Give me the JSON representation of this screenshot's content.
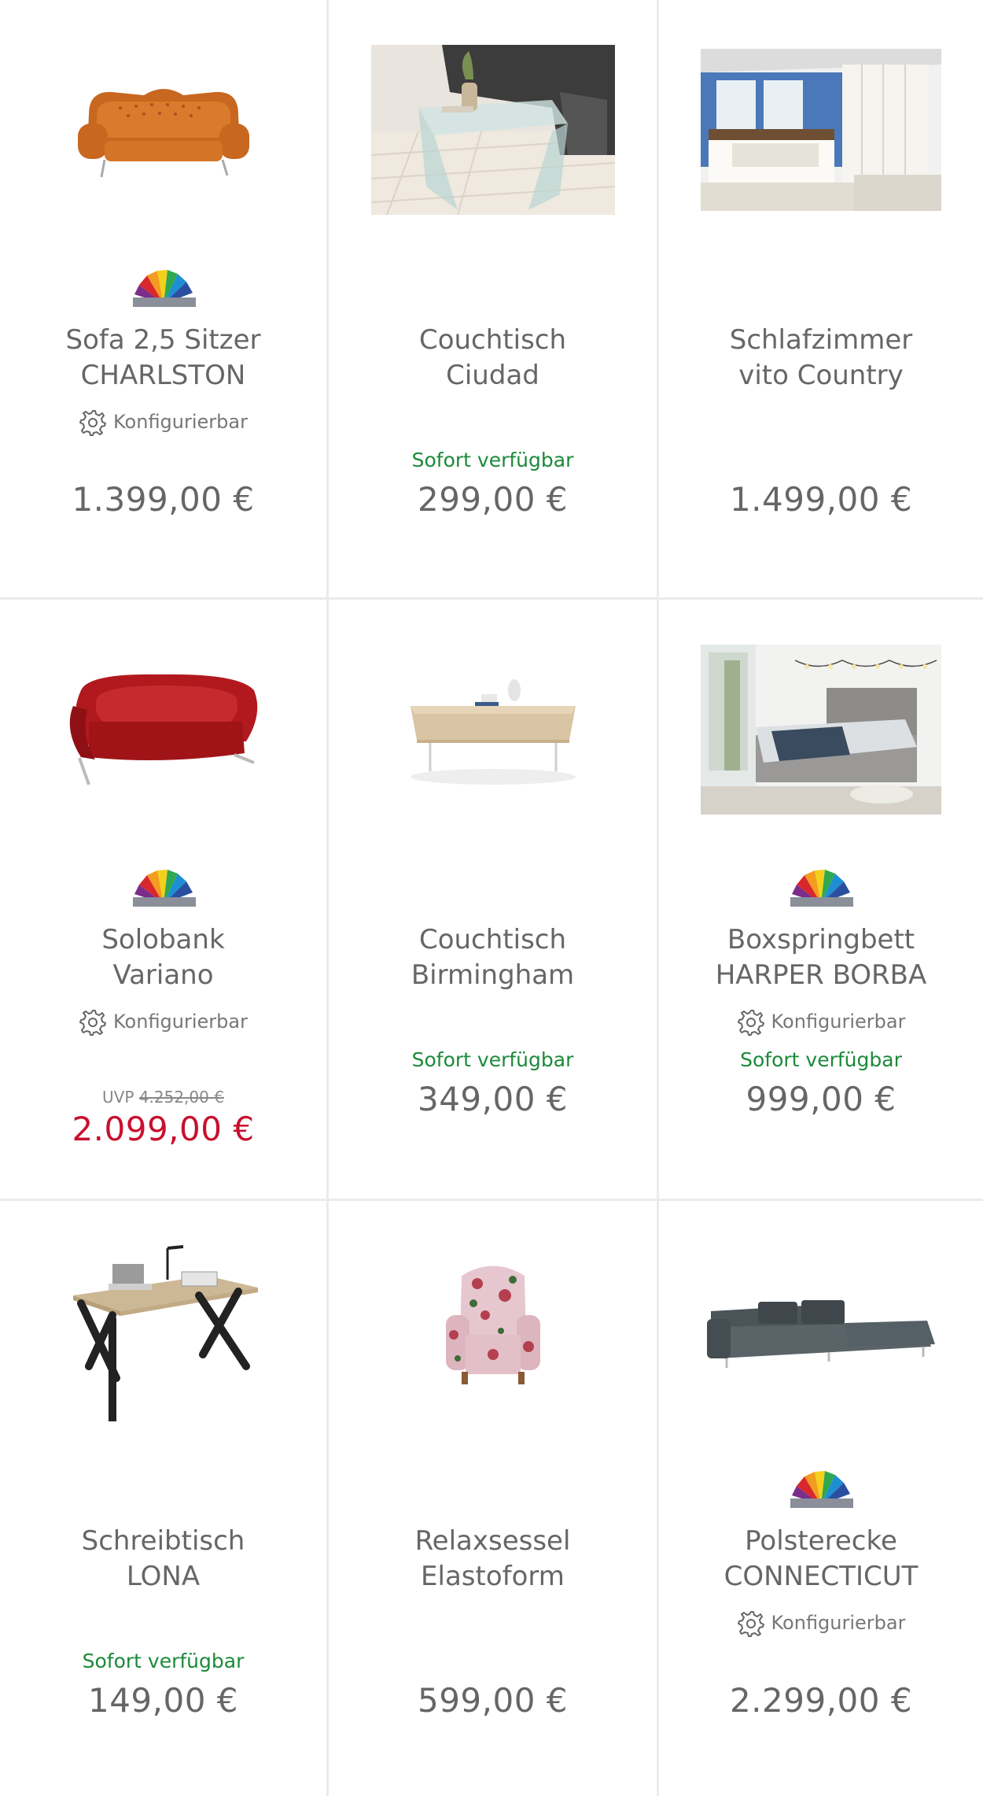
{
  "colors": {
    "price": "#666666",
    "sale_price": "#c8102e",
    "availability": "#1b8a3a",
    "divider": "#ebebeb"
  },
  "products": [
    {
      "image": "orange tufted sofa",
      "title_line1": "Sofa 2,5 Sitzer",
      "title_line2": "CHARLSTON",
      "configurable": "Konfigurierbar",
      "availability": "",
      "uvp_label": "",
      "uvp_value": "",
      "price": "1.399,00 €",
      "color_palette": true
    },
    {
      "image": "glass coffee table",
      "title_line1": "Couchtisch",
      "title_line2": "Ciudad",
      "configurable": "",
      "availability": "Sofort verfügbar",
      "price": "299,00 €",
      "color_palette": false
    },
    {
      "image": "white country bedroom set",
      "title_line1": "Schlafzimmer",
      "title_line2": "vito Country",
      "configurable": "",
      "availability": "",
      "price": "1.499,00 €",
      "color_palette": false
    },
    {
      "image": "red curved bench",
      "title_line1": "Solobank",
      "title_line2": "Variano",
      "configurable": "Konfigurierbar",
      "availability": "",
      "uvp_label": "UVP",
      "uvp_value": "4.252,00 €",
      "price": "2.099,00 €",
      "color_palette": true
    },
    {
      "image": "oak coffee table with glass legs",
      "title_line1": "Couchtisch",
      "title_line2": "Birmingham",
      "configurable": "",
      "availability": "Sofort verfügbar",
      "price": "349,00 €",
      "color_palette": false
    },
    {
      "image": "grey boxspring bed",
      "title_line1": "Boxspringbett",
      "title_line2": "HARPER BORBA",
      "configurable": "Konfigurierbar",
      "availability": "Sofort verfügbar",
      "price": "999,00 €",
      "color_palette": true
    },
    {
      "image": "desk with black X legs",
      "title_line1": "Schreibtisch",
      "title_line2": "LONA",
      "configurable": "",
      "availability": "Sofort verfügbar",
      "price": "149,00 €",
      "color_palette": false
    },
    {
      "image": "floral armchair",
      "title_line1": "Relaxsessel",
      "title_line2": "Elastoform",
      "configurable": "",
      "availability": "",
      "price": "599,00 €",
      "color_palette": false
    },
    {
      "image": "grey corner sofa",
      "title_line1": "Polsterecke",
      "title_line2": "CONNECTICUT",
      "configurable": "Konfigurierbar",
      "availability": "",
      "price": "2.299,00 €",
      "color_palette": true
    }
  ]
}
